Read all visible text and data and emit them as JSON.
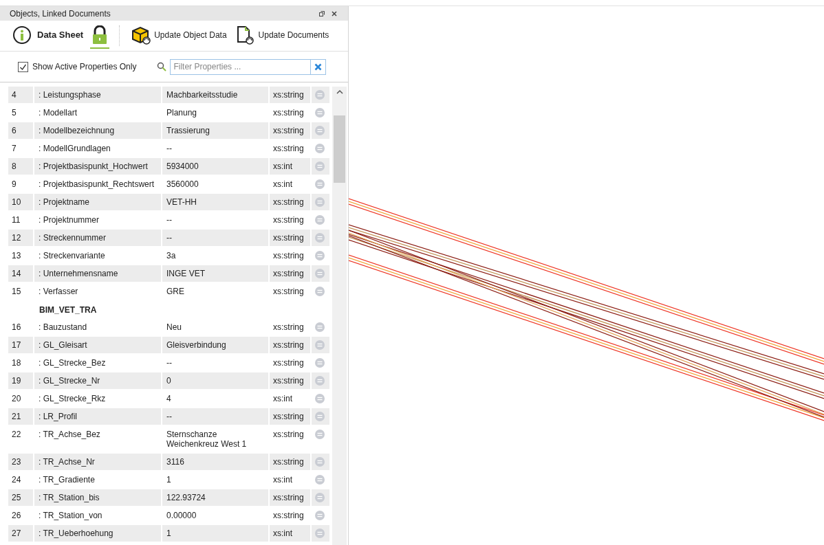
{
  "panel": {
    "title": "Objects, Linked Documents"
  },
  "toolbar": [
    {
      "kind": "info",
      "label": "Data Sheet",
      "selected": false
    },
    {
      "kind": "lock",
      "selected": true
    },
    {
      "kind": "cube",
      "label": "Update Object Data",
      "selected": false
    },
    {
      "kind": "document",
      "label": "Update Documents",
      "selected": false
    }
  ],
  "filter": {
    "checkbox_label": "Show Active Properties Only",
    "checked": true,
    "placeholder": "Filter Properties ..."
  },
  "rows": [
    {
      "kind": "property",
      "index": "4",
      "name": ": Leistungsphase",
      "value": "Machbarkeitsstudie",
      "type": "xs:string"
    },
    {
      "kind": "property",
      "index": "5",
      "name": ": Modellart",
      "value": "Planung",
      "type": "xs:string"
    },
    {
      "kind": "property",
      "index": "6",
      "name": ": Modellbezeichnung",
      "value": "Trassierung",
      "type": "xs:string"
    },
    {
      "kind": "property",
      "index": "7",
      "name": ": ModellGrundlagen",
      "value": "--",
      "type": "xs:string"
    },
    {
      "kind": "property",
      "index": "8",
      "name": ": Projektbasispunkt_Hochwert",
      "value": "5934000",
      "type": "xs:int"
    },
    {
      "kind": "property",
      "index": "9",
      "name": ": Projektbasispunkt_Rechtswert",
      "value": "3560000",
      "type": "xs:int"
    },
    {
      "kind": "property",
      "index": "10",
      "name": ": Projektname",
      "value": "VET-HH",
      "type": "xs:string"
    },
    {
      "kind": "property",
      "index": "11",
      "name": ": Projektnummer",
      "value": "--",
      "type": "xs:string"
    },
    {
      "kind": "property",
      "index": "12",
      "name": ": Streckennummer",
      "value": "--",
      "type": "xs:string"
    },
    {
      "kind": "property",
      "index": "13",
      "name": ": Streckenvariante",
      "value": "3a",
      "type": "xs:string"
    },
    {
      "kind": "property",
      "index": "14",
      "name": ": Unternehmensname",
      "value": "INGE VET",
      "type": "xs:string"
    },
    {
      "kind": "property",
      "index": "15",
      "name": ": Verfasser",
      "value": "GRE",
      "type": "xs:string"
    },
    {
      "kind": "group",
      "name": "BIM_VET_TRA"
    },
    {
      "kind": "property",
      "index": "16",
      "name": ": Bauzustand",
      "value": "Neu",
      "type": "xs:string"
    },
    {
      "kind": "property",
      "index": "17",
      "name": ": GL_Gleisart",
      "value": "Gleisverbindung",
      "type": "xs:string"
    },
    {
      "kind": "property",
      "index": "18",
      "name": ": GL_Strecke_Bez",
      "value": "--",
      "type": "xs:string"
    },
    {
      "kind": "property",
      "index": "19",
      "name": ": GL_Strecke_Nr",
      "value": "0",
      "type": "xs:string"
    },
    {
      "kind": "property",
      "index": "20",
      "name": ": GL_Strecke_Rkz",
      "value": "4",
      "type": "xs:int"
    },
    {
      "kind": "property",
      "index": "21",
      "name": ": LR_Profil",
      "value": "--",
      "type": "xs:string"
    },
    {
      "kind": "property",
      "index": "22",
      "name": ": TR_Achse_Bez",
      "value": "Sternschanze Weichenkreuz West 1",
      "type": "xs:string"
    },
    {
      "kind": "property",
      "index": "23",
      "name": ": TR_Achse_Nr",
      "value": "3116",
      "type": "xs:string"
    },
    {
      "kind": "property",
      "index": "24",
      "name": ": TR_Gradiente",
      "value": "1",
      "type": "xs:int"
    },
    {
      "kind": "property",
      "index": "25",
      "name": ": TR_Station_bis",
      "value": "122.93724",
      "type": "xs:string"
    },
    {
      "kind": "property",
      "index": "26",
      "name": ": TR_Station_von",
      "value": "0.00000",
      "type": "xs:string"
    },
    {
      "kind": "property",
      "index": "27",
      "name": ": TR_Ueberhoehung",
      "value": "1",
      "type": "xs:int"
    }
  ]
}
